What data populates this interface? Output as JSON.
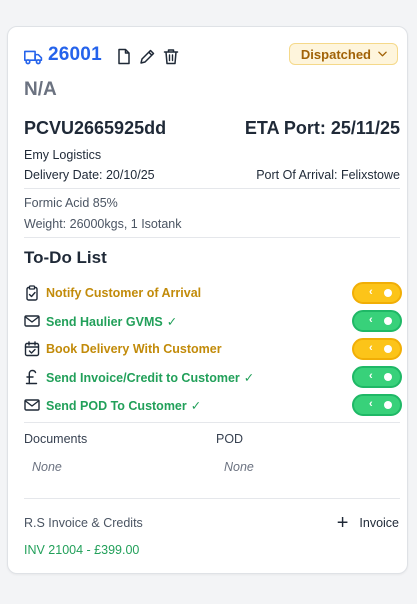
{
  "header": {
    "job_id": "26001",
    "status": "Dispatched",
    "subtitle": "N/A"
  },
  "shipment": {
    "container_no": "PCVU2665925dd",
    "eta_port": "ETA Port: 25/11/25",
    "haulier": "Emy Logistics",
    "delivery_date": "Delivery Date: 20/10/25",
    "port_of_arrival": "Port Of Arrival: Felixstowe",
    "cargo": "Formic Acid 85%",
    "weight": "Weight: 26000kgs, 1 Isotank"
  },
  "todo": {
    "title": "To-Do List",
    "items": [
      {
        "label": "Notify Customer of Arrival",
        "done": false,
        "icon": "clipboard-check-icon"
      },
      {
        "label": "Send Haulier GVMS",
        "done": true,
        "icon": "mail-icon"
      },
      {
        "label": "Book Delivery With Customer",
        "done": false,
        "icon": "calendar-check-icon"
      },
      {
        "label": "Send Invoice/Credit to Customer",
        "done": true,
        "icon": "pound-sign-icon"
      },
      {
        "label": "Send POD To Customer",
        "done": true,
        "icon": "mail-icon"
      }
    ],
    "check_glyph": "✓",
    "toggle_arrow": "‹"
  },
  "documents": {
    "documents_label": "Documents",
    "documents_value": "None",
    "pod_label": "POD",
    "pod_value": "None"
  },
  "invoices": {
    "label": "R.S Invoice & Credits",
    "add_button_label": "Invoice",
    "add_glyph": "+",
    "entry": "INV 21004 - £399.00"
  },
  "colors": {
    "accent_blue": "#2563eb",
    "amber": "#fcc419",
    "green": "#38d17a"
  }
}
